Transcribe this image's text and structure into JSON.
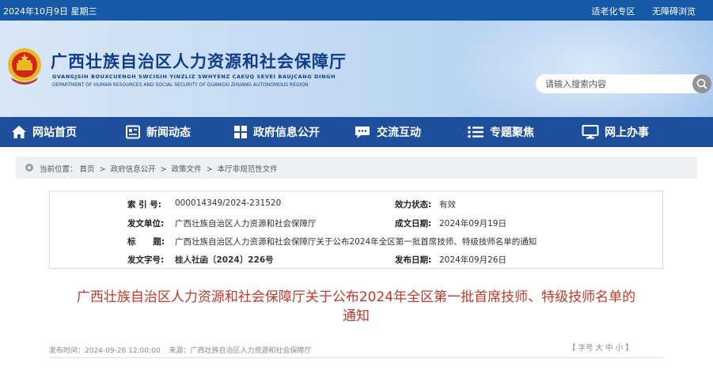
{
  "topbar": {
    "date": "2024年10月9日 星期三",
    "elderly_mode": "适老化专区",
    "accessibility": "无障碍浏览"
  },
  "header": {
    "title": "广西壮族自治区人力资源和社会保障厅",
    "pinyin": "GVANGJSIH BOUXCUENGH SWCIGIH YINZLIZ SWHYENZ CAEUQ SEVEI BAUJCANG DINGH",
    "english": "DEPARTMENT OF HUMAN RESOURCES AND SOCIAL SECURITY OF GUANGXI ZHUANG AUTONOMOUS REGION"
  },
  "search": {
    "placeholder": "请输入搜索内容",
    "icon": "search-icon"
  },
  "nav": {
    "items": [
      {
        "label": "网站首页",
        "icon": "home-icon"
      },
      {
        "label": "新闻动态",
        "icon": "newspaper-icon"
      },
      {
        "label": "政府信息公开",
        "icon": "grid-icon"
      },
      {
        "label": "交流互动",
        "icon": "chat-icon"
      },
      {
        "label": "专题聚焦",
        "icon": "list-icon"
      },
      {
        "label": "网上办事",
        "icon": "monitor-icon"
      }
    ]
  },
  "breadcrumb": {
    "prefix": "当前位置：",
    "items": [
      "首页",
      "政府信息公开",
      "政策文件",
      "本厅非规范性文件"
    ],
    "separator": ">"
  },
  "info": {
    "index_label": "索 引 号:",
    "index_value": "000014349/2024-231520",
    "validity_label": "效力状态:",
    "validity_value": "有效",
    "issuer_label": "发文单位:",
    "issuer_value": "广西壮族自治区人力资源和社会保障厅",
    "created_label": "成文日期:",
    "created_value": "2024年09月19日",
    "title_label": "标      题:",
    "title_value": "广西壮族自治区人力资源和社会保障厅关于公布2024年全区第一批首席技师、特级技师名单的通知",
    "docno_label": "发文字号:",
    "docno_value": "桂人社函〔2024〕226号",
    "published_label": "发布日期:",
    "published_value": "2024年09月26日"
  },
  "article": {
    "title_line1": "广西壮族自治区人力资源和社会保障厅关于公布2024年全区第一批首席技师、特级技师名单的",
    "title_line2": "通知",
    "publish_time": "发布时间：2024-09-26 12:00:00",
    "source": "来源：广西壮族自治区人力资源和社会保障厅",
    "fontsize_label": "【 字号 ",
    "size_large": "大",
    "size_medium": "中",
    "size_small": "小",
    "fontsize_end": " 】"
  },
  "colors": {
    "topbar": "#1458a6",
    "nav": "#1e4f9c",
    "title_blue": "#0f3c88",
    "article_red": "#c0392b"
  }
}
